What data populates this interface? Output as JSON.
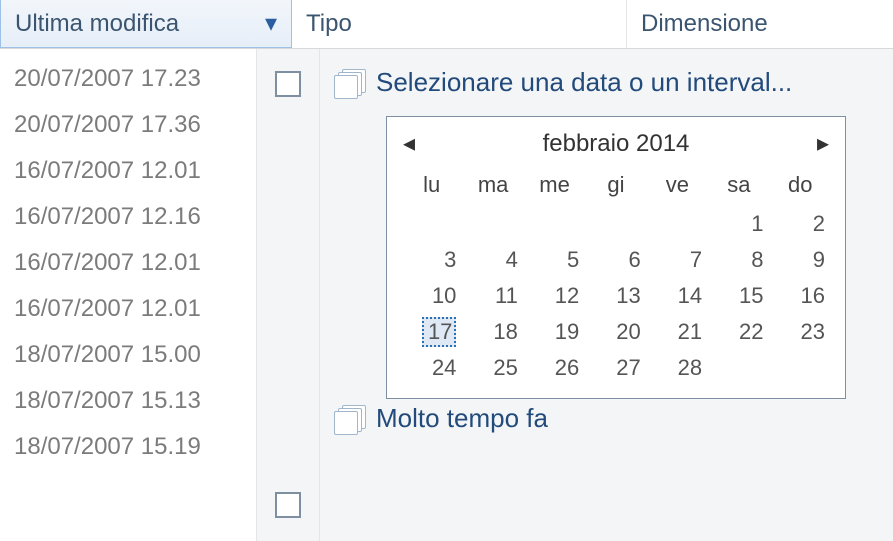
{
  "headers": {
    "active": "Ultima modifica",
    "tipo": "Tipo",
    "dim": "Dimensione"
  },
  "dates": [
    "20/07/2007 17.23",
    "20/07/2007 17.36",
    "16/07/2007 12.01",
    "16/07/2007 12.16",
    "16/07/2007 12.01",
    "16/07/2007 12.01",
    "18/07/2007 15.00",
    "18/07/2007 15.13",
    "18/07/2007 15.19"
  ],
  "filter_top": "Selezionare una data o un interval...",
  "filter_bottom": "Molto tempo fa",
  "calendar": {
    "title": "febbraio 2014",
    "prev": "◂",
    "next": "▸",
    "dows": [
      "lu",
      "ma",
      "me",
      "gi",
      "ve",
      "sa",
      "do"
    ],
    "weeks": [
      [
        "",
        "",
        "",
        "",
        "",
        "1",
        "2"
      ],
      [
        "3",
        "4",
        "5",
        "6",
        "7",
        "8",
        "9"
      ],
      [
        "10",
        "11",
        "12",
        "13",
        "14",
        "15",
        "16"
      ],
      [
        "17",
        "18",
        "19",
        "20",
        "21",
        "22",
        "23"
      ],
      [
        "24",
        "25",
        "26",
        "27",
        "28",
        "",
        ""
      ]
    ],
    "today": "17"
  }
}
